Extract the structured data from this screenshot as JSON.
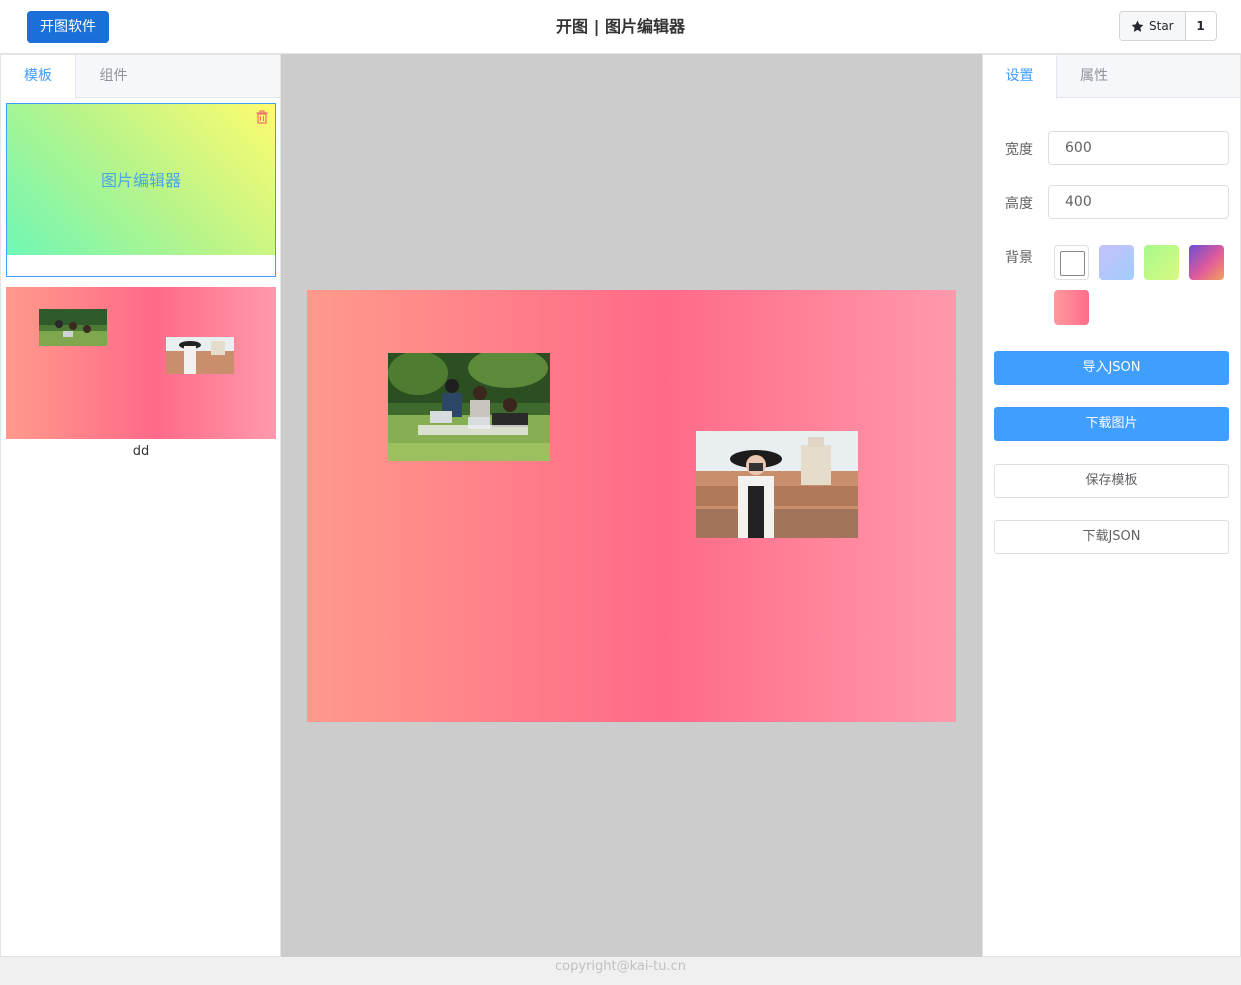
{
  "header": {
    "brand_label": "开图软件",
    "title": "开图 | 图片编辑器",
    "star_label": "Star",
    "star_count": "1"
  },
  "left_panel": {
    "tabs": [
      {
        "label": "模板",
        "active": true
      },
      {
        "label": "组件",
        "active": false
      }
    ],
    "templates": [
      {
        "preview_text": "图片编辑器",
        "name": ""
      },
      {
        "preview_text": "",
        "name": "dd"
      }
    ]
  },
  "right_panel": {
    "tabs": [
      {
        "label": "设置",
        "active": true
      },
      {
        "label": "属性",
        "active": false
      }
    ],
    "width_label": "宽度",
    "width_value": "600",
    "height_label": "高度",
    "height_value": "400",
    "background_label": "背景",
    "background_swatches": [
      "#ffffff",
      "#c6c1fb→#a1cdfd",
      "#a8f98e→#d8f97f",
      "#6a4fd1→#f3a05a",
      "#ff9a9e→#fe6c8a"
    ],
    "buttons": {
      "import_json": "导入JSON",
      "download_image": "下载图片",
      "save_template": "保存模板",
      "download_json": "下载JSON"
    }
  },
  "footer": {
    "copyright": "copyright@kai-tu.cn"
  },
  "colors": {
    "brand": "#1a6fd8",
    "accent": "#409eff",
    "canvas_gradient": [
      "#ff9a8b",
      "#ff6a88",
      "#ff99ac"
    ]
  }
}
